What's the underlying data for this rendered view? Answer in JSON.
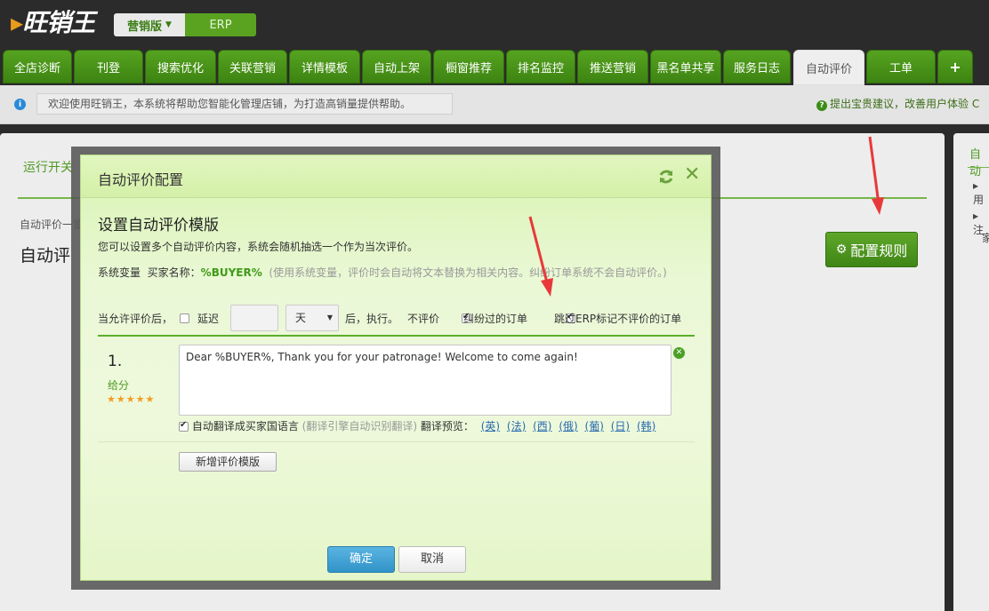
{
  "header": {
    "logo_text": "旺销王",
    "edition_selected": "营销版",
    "edition_other": "ERP"
  },
  "nav": {
    "tabs": [
      "全店诊断",
      "刊登",
      "搜索优化",
      "关联营销",
      "详情模板",
      "自动上架",
      "橱窗推荐",
      "排名监控",
      "推送营销",
      "黑名单共享",
      "服务日志",
      "自动评价",
      "工单",
      "+"
    ],
    "active": "自动评价"
  },
  "infobar": {
    "message": "欢迎使用旺销王，本系统将帮助您智能化管理店铺，为打造高销量提供帮助。",
    "suggest": "提出宝贵建议，改善用户体验 C"
  },
  "page": {
    "run_tab": "运行开关",
    "crumb": "自动评价一览",
    "title": "自动评",
    "config_button": "配置规则"
  },
  "side": {
    "title": "自动",
    "items": [
      "用",
      "注",
      "家"
    ]
  },
  "modal": {
    "title": "自动评价配置",
    "section_title": "设置自动评价模版",
    "description": "您可以设置多个自动评价内容，系统会随机抽选一个作为当次评价。",
    "vars_label": "系统变量",
    "buyer_label": "买家名称：",
    "buyer_var": "%BUYER%",
    "vars_note": "(使用系统变量，评价时会自动将文本替换为相关内容。纠纷订单系统不会自动评价。)",
    "options": {
      "prefix": "当允许评价后，",
      "delay_label": "延迟",
      "delay_value": "",
      "unit": "天",
      "suffix": "后，执行。",
      "no_eval_label": "不评价",
      "dispute_label": "纠纷过的订单",
      "skip_erp_label": "跳过ERP标记不评价的订单"
    },
    "template": {
      "number": "1.",
      "score_label": "给分",
      "stars": "★★★★★",
      "rating": 5,
      "message": "Dear %BUYER%, Thank you for your patronage! Welcome to come again!",
      "auto_translate_label": "自动翻译成买家国语言",
      "translate_note": "(翻译引擎自动识别翻译)",
      "preview_label": "翻译预览：",
      "languages": [
        "(英)",
        "(法)",
        "(西)",
        "(俄)",
        "(葡)",
        "(日)",
        "(韩)"
      ]
    },
    "add_template_button": "新增评价模版",
    "ok_button": "确定",
    "cancel_button": "取消"
  },
  "colors": {
    "brand_green": "#4a9a1c",
    "annotation_red": "#e8393a",
    "primary_blue": "#3a9fd4"
  }
}
